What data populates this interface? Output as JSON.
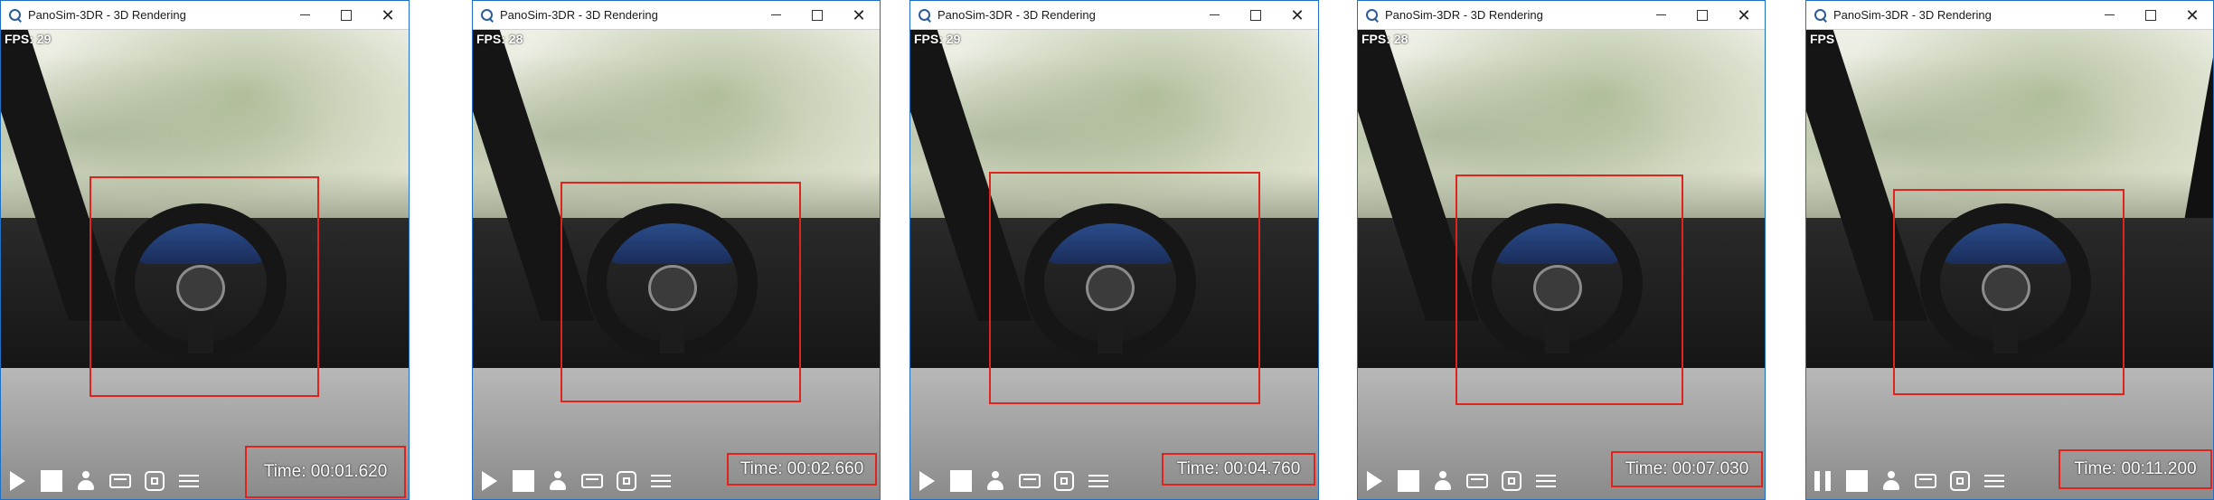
{
  "windows": [
    {
      "title": "PanoSim-3DR - 3D Rendering",
      "fps": "FPS: 29",
      "time": "Time: 00:01.620",
      "playback": "play",
      "controls": {
        "minimize": "—",
        "maximize": "☐",
        "close": "✕"
      }
    },
    {
      "title": "PanoSim-3DR - 3D Rendering",
      "fps": "FPS: 28",
      "time": "Time: 00:02.660",
      "playback": "play",
      "controls": {
        "minimize": "—",
        "maximize": "☐",
        "close": "✕"
      }
    },
    {
      "title": "PanoSim-3DR - 3D Rendering",
      "fps": "FPS: 29",
      "time": "Time: 00:04.760",
      "playback": "play",
      "controls": {
        "minimize": "—",
        "maximize": "☐",
        "close": "✕"
      }
    },
    {
      "title": "PanoSim-3DR - 3D Rendering",
      "fps": "FPS: 28",
      "time": "Time: 00:07.030",
      "playback": "play",
      "controls": {
        "minimize": "—",
        "maximize": "☐",
        "close": "✕"
      }
    },
    {
      "title": "PanoSim-3DR - 3D Rendering",
      "fps": "FPS",
      "time": "Time: 00:11.200",
      "playback": "pause",
      "controls": {
        "minimize": "—",
        "maximize": "☐",
        "close": "✕"
      }
    }
  ],
  "toolbar_icons": [
    "play-icon",
    "stop-icon",
    "person-icon",
    "panorama-icon",
    "fullscreen-icon",
    "list-icon"
  ],
  "colors": {
    "accent_border": "#1f6fc5",
    "highlight_box": "#e0231c",
    "overlay_text": "#ffffff"
  }
}
